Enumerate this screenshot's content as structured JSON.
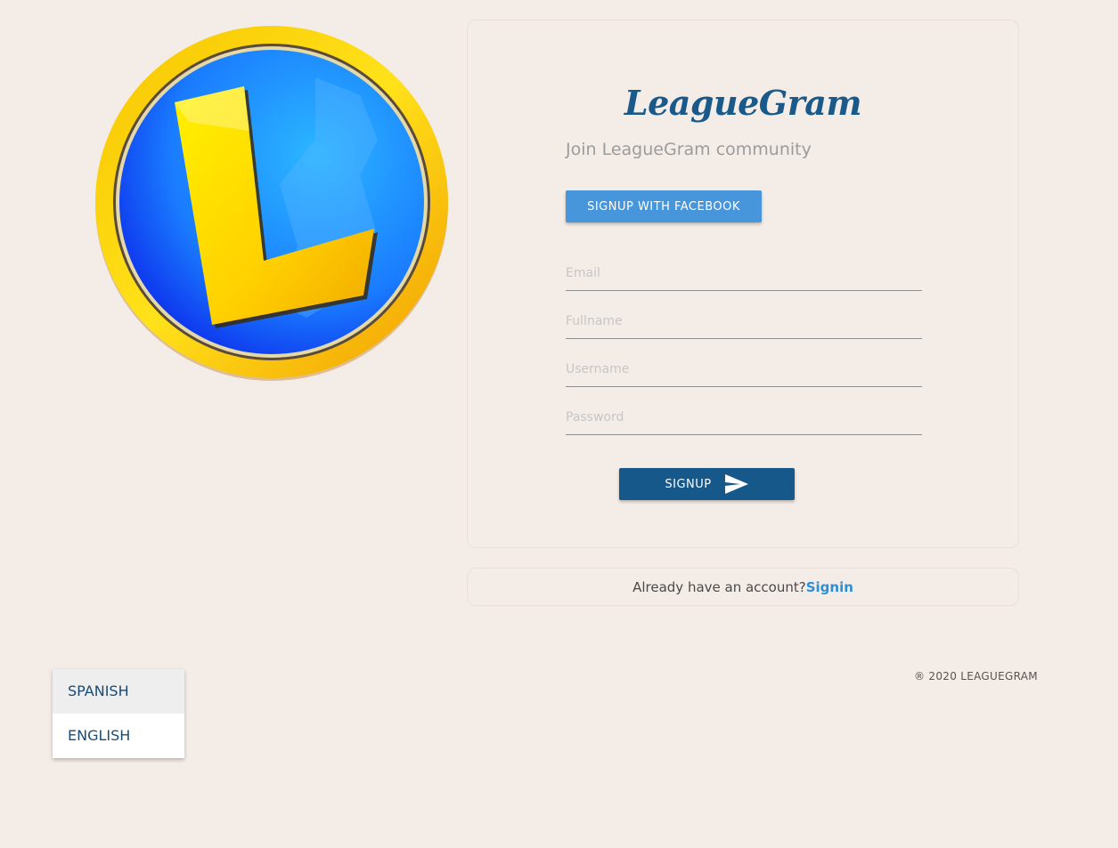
{
  "brand": {
    "name": "LeagueGram",
    "colors": {
      "primary": "#16588a",
      "facebook": "#4795db",
      "link": "#2d8fd6",
      "background": "#f4ece7"
    }
  },
  "logo": {
    "icon": "league-l-emblem-icon",
    "letter": "L"
  },
  "signup_card": {
    "tagline": "Join LeagueGram community",
    "facebook_button": "SIGNUP WITH FACEBOOK",
    "fields": {
      "email_placeholder": "Email",
      "fullname_placeholder": "Fullname",
      "username_placeholder": "Username",
      "password_placeholder": "Password"
    },
    "signup_button": "SIGNUP",
    "signup_icon": "send-icon"
  },
  "signin_bar": {
    "prompt": "Already have an account?",
    "link": "Signin"
  },
  "language_menu": {
    "items": [
      "SPANISH",
      "ENGLISH"
    ],
    "highlighted": "SPANISH"
  },
  "footer": {
    "copyright": "® 2020 LEAGUEGRAM"
  }
}
